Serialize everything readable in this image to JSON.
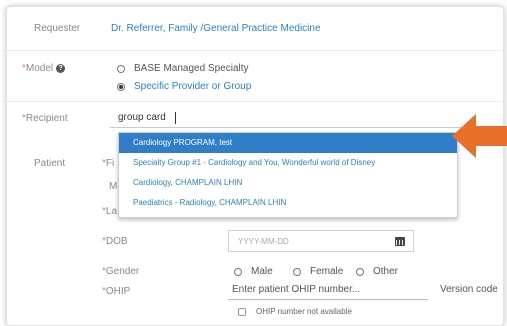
{
  "requester": {
    "label": "Requester",
    "value": "Dr. Referrer, Family /General Practice Medicine"
  },
  "model": {
    "label": "Model",
    "required_mark": "*",
    "help_glyph": "?",
    "options": [
      {
        "label": "BASE Managed Specialty",
        "selected": false
      },
      {
        "label": "Specific Provider or Group",
        "selected": true
      }
    ]
  },
  "recipient": {
    "label": "Recipient",
    "required_mark": "*",
    "value": "group card",
    "suggestions": [
      {
        "label": "Cardiology PROGRAM, test",
        "active": true
      },
      {
        "label": "Specialty Group #1 - Cardiology and You, Wonderful world of Disney",
        "active": false
      },
      {
        "label": "Cardiology, CHAMPLAIN LHIN",
        "active": false
      },
      {
        "label": "Paediatrics - Radiology, CHAMPLAIN LHIN",
        "active": false
      }
    ]
  },
  "patient": {
    "label": "Patient",
    "first_label_partial": "Fi",
    "middle_label_partial": "M",
    "last_label_partial": "La",
    "dob": {
      "label": "DOB",
      "placeholder": "YYYY-MM-DD"
    },
    "gender": {
      "label": "Gender",
      "options": [
        "Male",
        "Female",
        "Other"
      ]
    },
    "ohip": {
      "label": "OHIP",
      "placeholder": "Enter patient OHIP number...",
      "version_label": "Version code",
      "not_available_label": "OHIP number not available"
    }
  },
  "colors": {
    "accent_blue": "#2a82c6",
    "required_orange": "#e8863f",
    "arrow": "#e8702a"
  },
  "icons": {
    "help": "question-circle-icon",
    "calendar": "calendar-icon",
    "pointer": "arrow-left-icon"
  }
}
